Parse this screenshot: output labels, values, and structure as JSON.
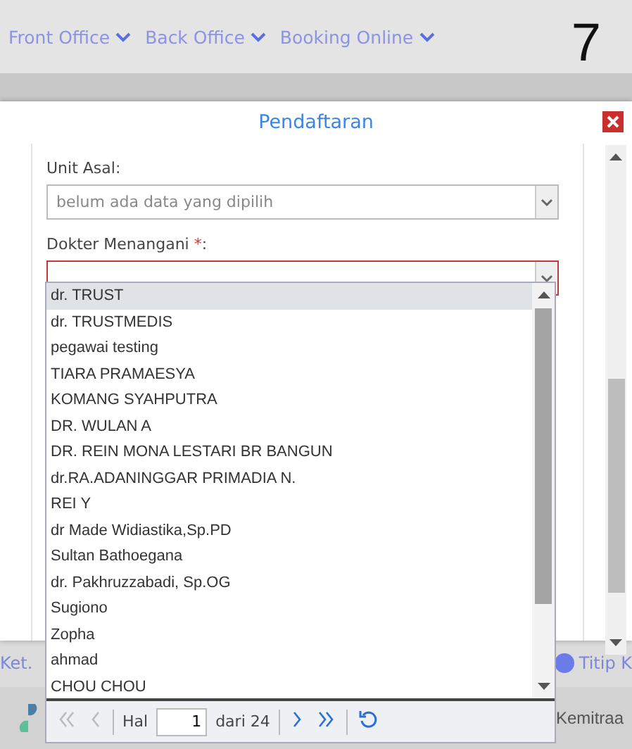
{
  "nav": {
    "items": [
      {
        "label": "Front Office"
      },
      {
        "label": "Back Office"
      },
      {
        "label": "Booking Online"
      }
    ],
    "badge": "7"
  },
  "legend": {
    "left": "Ket.",
    "dot_label": "Titip K"
  },
  "footer": {
    "label": "Kemitraa"
  },
  "dialog": {
    "title": "Pendaftaran",
    "fields": [
      {
        "label": "Unit Asal:",
        "placeholder": "belum ada data yang dipilih",
        "invalid": false
      },
      {
        "label": "Dokter Menangani ",
        "required_mark": "*",
        "suffix": ":",
        "invalid": true
      }
    ],
    "options": [
      {
        "label": "dr. TRUST",
        "selected": true
      },
      {
        "label": "dr. TRUSTMEDIS",
        "selected": false
      },
      {
        "label": "pegawai testing",
        "selected": false
      },
      {
        "label": "TIARA PRAMAESYA",
        "selected": false
      },
      {
        "label": "KOMANG SYAHPUTRA",
        "selected": false
      },
      {
        "label": "DR. WULAN A",
        "selected": false
      },
      {
        "label": "DR. REIN MONA LESTARI BR BANGUN",
        "selected": false
      },
      {
        "label": "dr.RA.ADANINGGAR PRIMADIA N.",
        "selected": false
      },
      {
        "label": "REI Y",
        "selected": false
      },
      {
        "label": "dr Made Widiastika,Sp.PD",
        "selected": false
      },
      {
        "label": "Sultan Bathoegana",
        "selected": false
      },
      {
        "label": "dr. Pakhruzzabadi, Sp.OG",
        "selected": false
      },
      {
        "label": "Sugiono",
        "selected": false
      },
      {
        "label": "Zopha",
        "selected": false
      },
      {
        "label": "ahmad",
        "selected": false
      },
      {
        "label": "CHOU CHOU",
        "selected": false
      }
    ],
    "pager": {
      "page_label": "Hal",
      "page": "1",
      "of_label": "dari 24",
      "first_disabled": true,
      "prev_disabled": true
    }
  }
}
